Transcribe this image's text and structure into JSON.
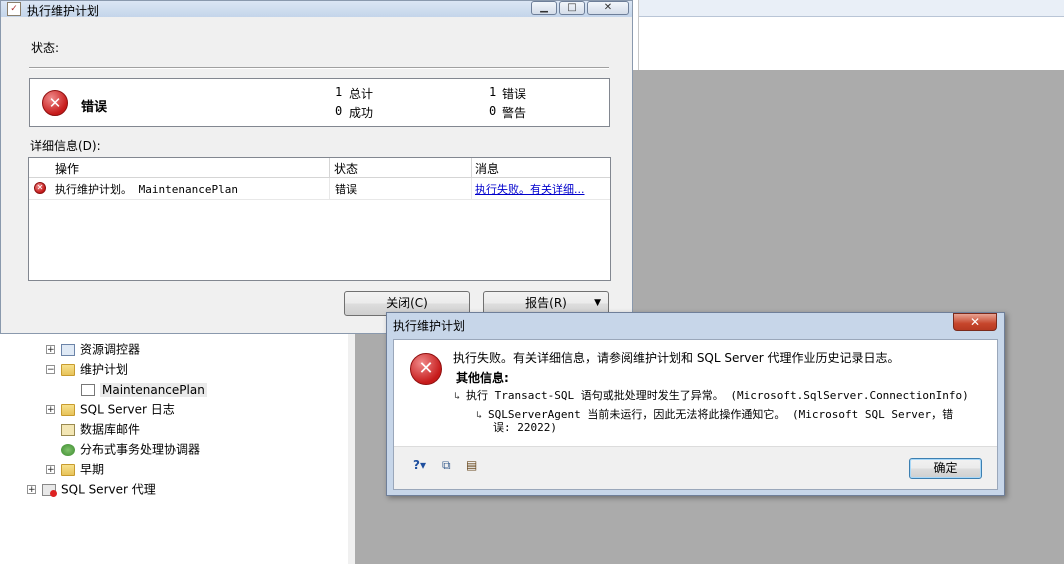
{
  "main_dialog": {
    "title": "执行维护计划",
    "status_label": "状态:",
    "status_word": "错误",
    "stats": {
      "total_count": "1",
      "total_label": "总计",
      "success_count": "0",
      "success_label": "成功",
      "error_count": "1",
      "error_label": "错误",
      "warning_count": "0",
      "warning_label": "警告"
    },
    "details_label": "详细信息(D):",
    "grid": {
      "columns": [
        "操作",
        "状态",
        "消息"
      ],
      "rows": [
        {
          "action": "执行维护计划。 MaintenancePlan",
          "status": "错误",
          "message": "执行失败。有关详细..."
        }
      ]
    },
    "close_button": "关闭(C)",
    "report_button": "报告(R)"
  },
  "tree": {
    "items": [
      {
        "label": "资源调控器",
        "icon": "resource-governor-icon"
      },
      {
        "label": "维护计划",
        "icon": "folder-icon"
      },
      {
        "label": "MaintenancePlan",
        "icon": "maintenance-plan-icon"
      },
      {
        "label": "SQL Server 日志",
        "icon": "folder-icon"
      },
      {
        "label": "数据库邮件",
        "icon": "database-mail-icon"
      },
      {
        "label": "分布式事务处理协调器",
        "icon": "dtc-icon"
      },
      {
        "label": "早期",
        "icon": "folder-icon"
      },
      {
        "label": "SQL Server 代理",
        "icon": "sql-agent-icon"
      }
    ]
  },
  "error_dialog": {
    "title": "执行维护计划",
    "message": "执行失败。有关详细信息，请参阅维护计划和 SQL Server 代理作业历史记录日志。",
    "other_info_label": "其他信息:",
    "line1": "执行 Transact-SQL 语句或批处理时发生了异常。 (Microsoft.SqlServer.ConnectionInfo)",
    "line2a": "SQLServerAgent 当前未运行，因此无法将此操作通知它。 (Microsoft SQL Server，错",
    "line2b": "误: 22022)",
    "ok_button": "确定"
  },
  "colors": {
    "error_red": "#c61a1a",
    "link_blue": "#0000cc",
    "workspace_gray": "#ababab"
  }
}
